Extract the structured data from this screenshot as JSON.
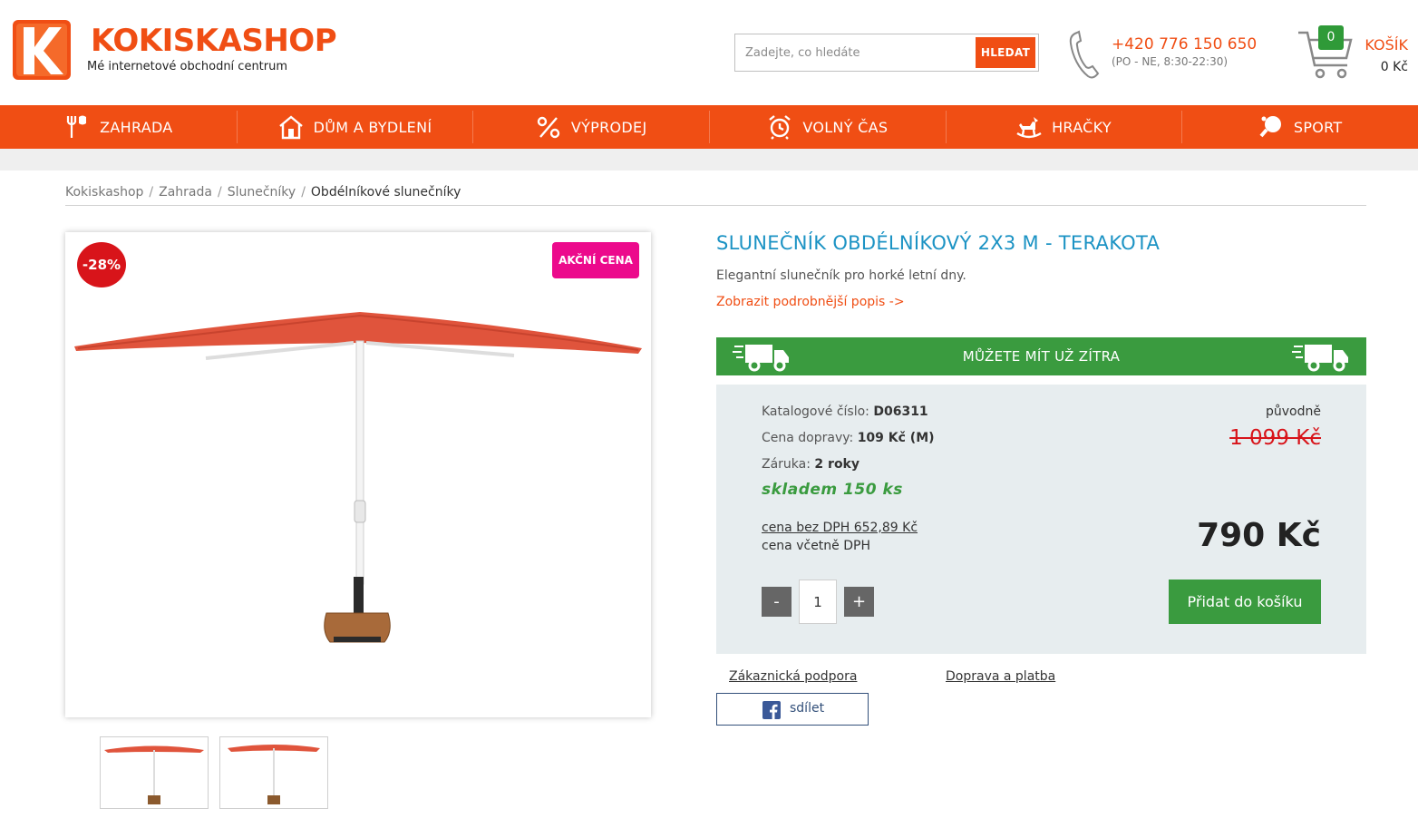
{
  "header": {
    "brand_name": "KOKISKASHOP",
    "tagline": "Mé internetové obchodní centrum",
    "logo_letter": "K",
    "search_placeholder": "Zadejte, co hledáte",
    "search_button": "HLEDAT",
    "phone": "+420 776 150 650",
    "phone_hours": "(PO - NE, 8:30-22:30)",
    "cart_count": "0",
    "cart_label": "KOŠÍK",
    "cart_total": "0 Kč"
  },
  "nav": {
    "items": [
      {
        "label": "ZAHRADA",
        "icon": "garden-tools-icon"
      },
      {
        "label": "DŮM A BYDLENÍ",
        "icon": "house-icon"
      },
      {
        "label": "VÝPRODEJ",
        "icon": "percent-icon"
      },
      {
        "label": "VOLNÝ ČAS",
        "icon": "alarm-clock-icon"
      },
      {
        "label": "HRAČKY",
        "icon": "rocking-horse-icon"
      },
      {
        "label": "SPORT",
        "icon": "ping-pong-icon"
      }
    ]
  },
  "breadcrumb": {
    "items": [
      "Kokiskashop",
      "Zahrada",
      "Slunečníky"
    ],
    "current": "Obdélníkové slunečníky",
    "separator": "/"
  },
  "product": {
    "discount": "-28%",
    "action_badge": "AKČNÍ CENA",
    "title": "SLUNEČNÍK OBDÉLNÍKOVÝ 2X3 M - TERAKOTA",
    "description": "Elegantní slunečník pro horké letní dny.",
    "more_link": "Zobrazit podrobnější popis ->",
    "delivery_banner": "MŮŽETE MÍT UŽ ZÍTRA",
    "catalog_label": "Katalogové číslo:",
    "catalog_value": "D06311",
    "shipping_label": "Cena dopravy:",
    "shipping_value": "109 Kč (M)",
    "warranty_label": "Záruka:",
    "warranty_value": "2 roky",
    "stock": "skladem 150 ks",
    "price_no_vat": "cena bez DPH 652,89 Kč",
    "price_with_vat_label": "cena včetně DPH",
    "original_label": "původně",
    "original_price": "1 099 Kč",
    "price": "790 Kč",
    "qty_minus": "-",
    "qty_plus": "+",
    "qty_value": "1",
    "add_to_cart": "Přidat do košíku",
    "support_link": "Zákaznická podpora",
    "shipping_link": "Doprava a platba",
    "share_label": "sdílet"
  },
  "colors": {
    "brand_orange": "#f04e14",
    "title_blue": "#1c93c4",
    "green": "#3a9b3f",
    "discount_red": "#d8141a",
    "action_pink": "#ec0a8c",
    "price_box_bg": "#e7edef"
  }
}
